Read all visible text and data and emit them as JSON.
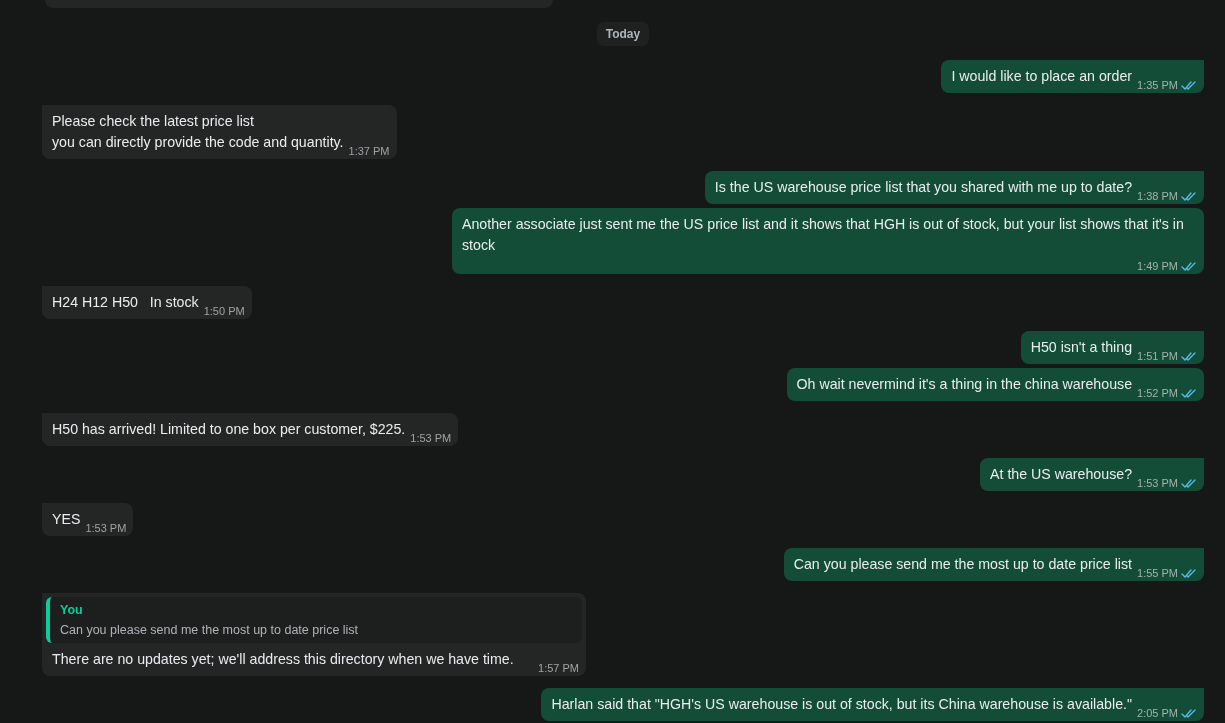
{
  "day_divider": "Today",
  "messages": [
    {
      "kind": "outgoing",
      "text": "I would like to place an order",
      "time": "1:35 PM",
      "read": true
    },
    {
      "kind": "incoming",
      "text": "Please check the latest price list\nyou can directly provide the code and quantity.",
      "time": "1:37 PM"
    },
    {
      "kind": "outgoing",
      "text": "Is the US warehouse price list that you shared with me up to date?",
      "time": "1:38 PM",
      "read": true
    },
    {
      "kind": "outgoing",
      "text": "Another associate just sent me the US price list and it shows that HGH is out of stock, but your list shows that it's in stock",
      "time": "1:49 PM",
      "read": true
    },
    {
      "kind": "incoming",
      "text": "H24 H12 H50   In stock",
      "time": "1:50 PM"
    },
    {
      "kind": "outgoing",
      "text": "H50 isn't a thing",
      "time": "1:51 PM",
      "read": true
    },
    {
      "kind": "outgoing",
      "text": "Oh wait nevermind it's a thing in the china warehouse",
      "time": "1:52 PM",
      "read": true
    },
    {
      "kind": "incoming",
      "text": "H50 has arrived! Limited to one box per customer, $225.",
      "time": "1:53 PM"
    },
    {
      "kind": "outgoing",
      "text": "At the US warehouse?",
      "time": "1:53 PM",
      "read": true
    },
    {
      "kind": "incoming",
      "text": "YES",
      "time": "1:53 PM"
    },
    {
      "kind": "outgoing",
      "text": "Can you please send me the most up to date price list",
      "time": "1:55 PM",
      "read": true
    },
    {
      "kind": "incoming",
      "reply_to": {
        "author": "You",
        "text": "Can you please send me the most up to date price list"
      },
      "text": "There are no updates yet; we'll address this directory when we have time.",
      "time": "1:57 PM"
    },
    {
      "kind": "outgoing",
      "text": "Harlan said that \"HGH's US warehouse is out of stock, but its China warehouse is available.\"",
      "time": "2:05 PM",
      "read": true
    }
  ]
}
